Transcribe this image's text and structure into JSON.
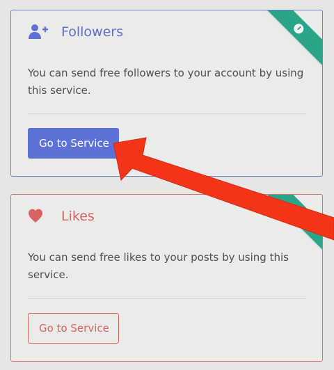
{
  "cards": [
    {
      "title": "Followers",
      "icon": "user-plus-icon",
      "description": "You can send free followers to your account by using this service.",
      "button_label": "Go to Service",
      "accent": "#5d72d6",
      "ribbon_icon": "clock-icon"
    },
    {
      "title": "Likes",
      "icon": "heart-icon",
      "description": "You can send free likes to your posts by using this service.",
      "button_label": "Go to Service",
      "accent": "#d96262",
      "ribbon_icon": "clock-icon"
    }
  ],
  "colors": {
    "background": "#e6e6e4",
    "ribbon": "#2aa58a",
    "annotation_arrow": "#f43418"
  }
}
